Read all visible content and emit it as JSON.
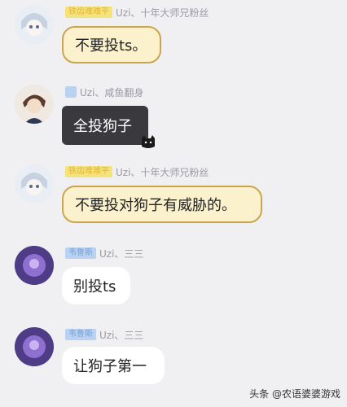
{
  "messages": [
    {
      "badge": "铁齿难难平",
      "names": "Uzi、十年大师兄粉丝",
      "text": "不要投ts。"
    },
    {
      "badge": "",
      "names": "Uzi、咸鱼翻身",
      "text": "全投狗子"
    },
    {
      "badge": "铁齿难难平",
      "names": "Uzi、十年大师兄粉丝",
      "text": "不要投对狗子有威胁的。"
    },
    {
      "badge": "韦鲁斯",
      "names": "Uzi、三三",
      "text": "别投ts"
    },
    {
      "badge": "韦鲁斯",
      "names": "Uzi、三三",
      "text": "让狗子第一"
    }
  ],
  "watermark": "头条 @农语婆婆游戏",
  "colors": {
    "background": "#f0f0f2",
    "gold_bubble": "#fbf1cd",
    "gold_border": "#c9a64e",
    "dark_bubble": "#3a3a3e",
    "name_text": "#9a9aa5"
  }
}
